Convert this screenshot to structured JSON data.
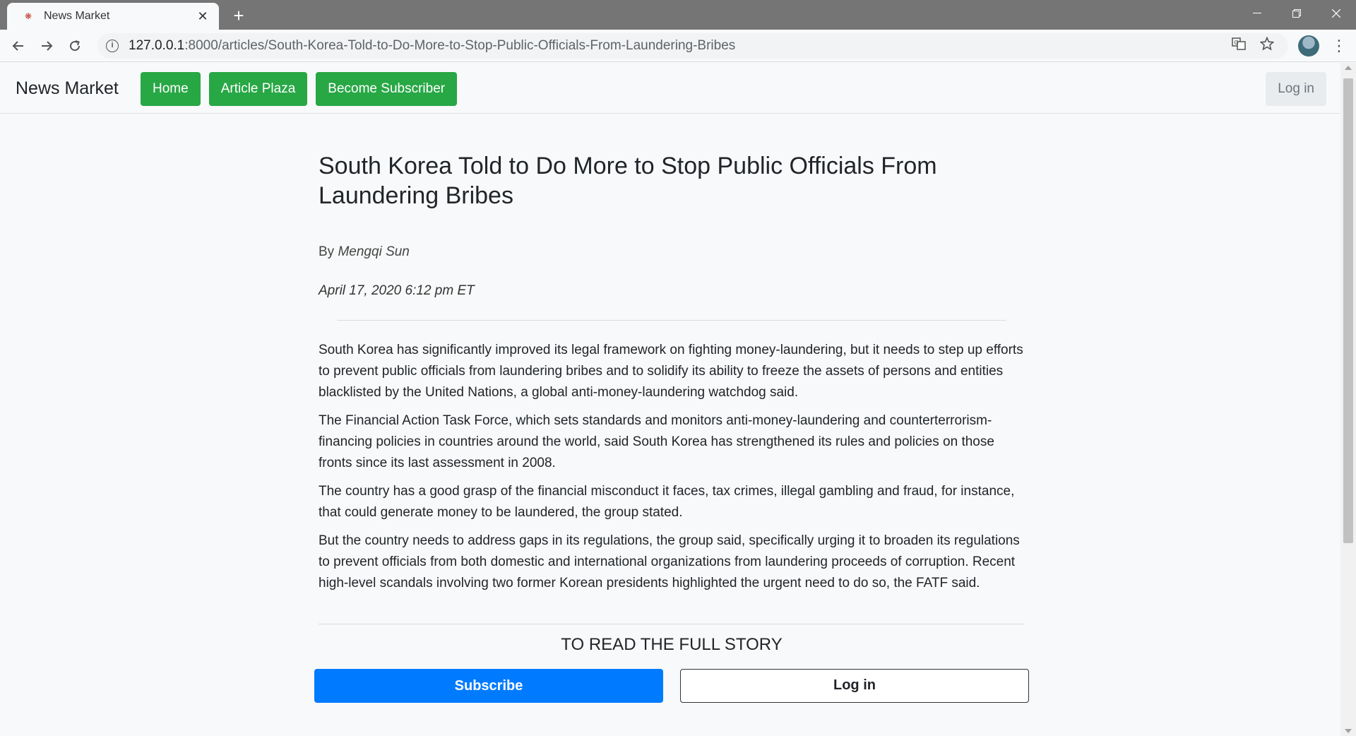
{
  "browser": {
    "tab_title": "News Market",
    "tab_close": "✕",
    "new_tab": "+",
    "url_host": "127.0.0.1",
    "url_path": ":8000/articles/South-Korea-Told-to-Do-More-to-Stop-Public-Officials-From-Laundering-Bribes",
    "icons": {
      "back": "back-arrow-icon",
      "forward": "forward-arrow-icon",
      "reload": "reload-icon",
      "info": "info-icon",
      "translate": "translate-icon",
      "bookmark": "star-icon",
      "menu": "kebab-menu-icon"
    }
  },
  "site": {
    "brand": "News Market",
    "nav": [
      "Home",
      "Article Plaza",
      "Become Subscriber"
    ],
    "login_top": "Log in",
    "colors": {
      "nav_green": "#28a745",
      "subscribe_blue": "#007bff"
    }
  },
  "article": {
    "title": "South Korea Told to Do More to Stop Public Officials From Laundering Bribes",
    "by_prefix": "By",
    "author": "Mengqi Sun",
    "date": "April 17, 2020 6:12 pm ET",
    "paragraphs": [
      "South Korea has significantly improved its legal framework on fighting money-laundering, but it needs to step up efforts to prevent public officials from laundering bribes and to solidify its ability to freeze the assets of persons and entities blacklisted by the United Nations, a global anti-money-laundering watchdog said.",
      "The Financial Action Task Force, which sets standards and monitors anti-money-laundering and counterterrorism-financing policies in countries around the world, said South Korea has strengthened its rules and policies on those fronts since its last assessment in 2008.",
      "The country has a good grasp of the financial misconduct it faces, tax crimes, illegal gambling and fraud, for instance, that could generate money to be laundered, the group stated.",
      "But the country needs to address gaps in its regulations, the group said, specifically urging it to broaden its regulations to prevent officials from both domestic and international organizations from laundering proceeds of corruption. Recent high-level scandals involving two former Korean presidents highlighted the urgent need to do so, the FATF said."
    ],
    "cta": "TO READ THE FULL STORY",
    "subscribe_label": "Subscribe",
    "login_label": "Log in"
  }
}
